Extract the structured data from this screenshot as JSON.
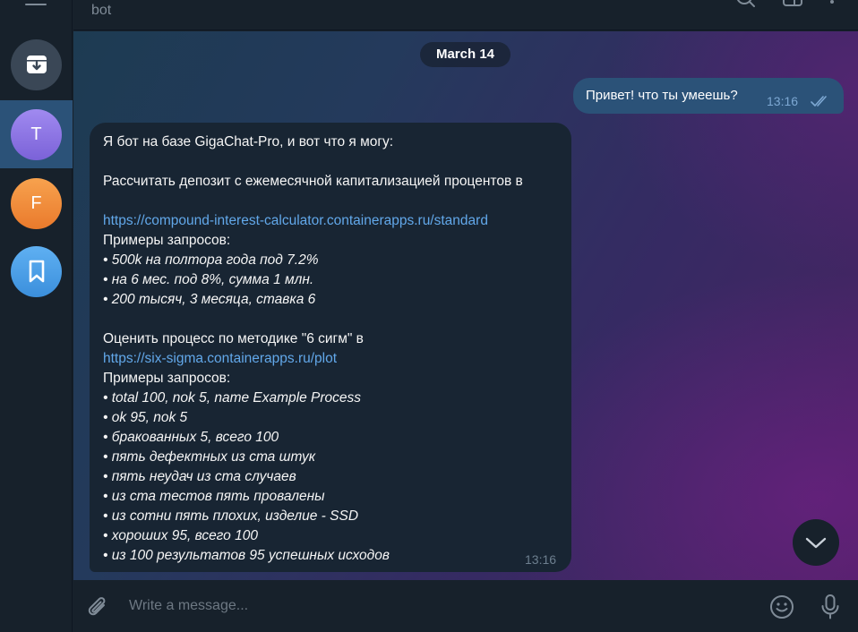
{
  "header": {
    "title": "bot"
  },
  "sidebar": {
    "items": [
      {
        "letter": "",
        "icon": "archive-icon",
        "color": "#3a4756"
      },
      {
        "letter": "T",
        "color": "#8b74e3"
      },
      {
        "letter": "F",
        "color": "#ef8a38"
      },
      {
        "letter": "",
        "icon": "bookmark-icon",
        "color": "#4a9fea"
      }
    ]
  },
  "chat": {
    "date": "March 14",
    "outgoing": {
      "text": "Привет! что ты умеешь?",
      "time": "13:16"
    },
    "incoming": {
      "time": "13:16",
      "lines": [
        "Я бот на базе GigaChat-Pro, и вот что я могу:",
        "",
        "Рассчитать депозит с ежемесячной капитализацией процентов в",
        "https://compound-interest-calculator.containerapps.ru/standard",
        "Примеры запросов:",
        "• 500k на полтора года под 7.2%",
        "• на 6 мес. под 8%, сумма 1 млн.",
        "• 200 тысяч, 3 месяца, ставка 6",
        "",
        "Оценить процесс по методике \"6 сигм\" в",
        "https://six-sigma.containerapps.ru/plot",
        "Примеры запросов:",
        "• total 100, nok 5, name Example Process",
        "• ok 95, nok 5",
        "• бракованных 5, всего 100",
        "• пять дефектных из ста штук",
        "• пять неудач из ста случаев",
        "• из ста тестов пять провалены",
        "• из сотни пять плохих, изделие - SSD",
        "• хороших 95, всего 100",
        "• из 100 результатов 95 успешных исходов"
      ]
    }
  },
  "composer": {
    "placeholder": "Write a message..."
  }
}
